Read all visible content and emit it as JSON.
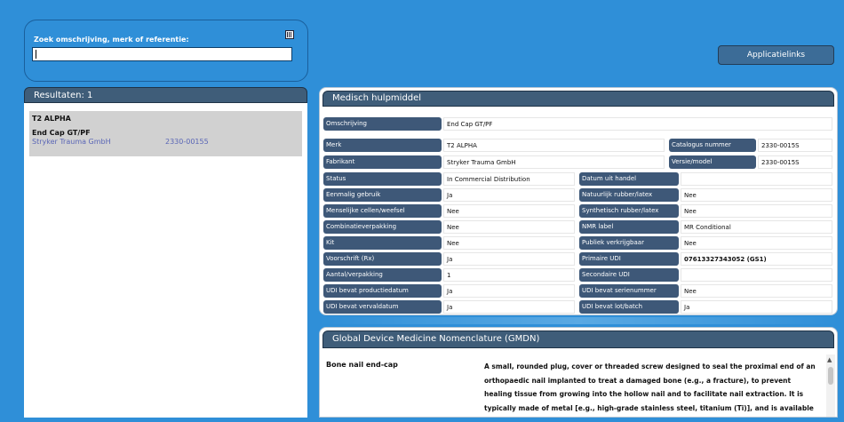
{
  "search": {
    "label": "Zoek omschrijving, merk of referentie:",
    "value": "",
    "placeholder": ""
  },
  "applinks_label": "Applicatielinks",
  "results": {
    "header": "Resultaten: 1",
    "item": {
      "brand": "T2 ALPHA",
      "description": "End Cap GT/PF",
      "manufacturer": "Stryker Trauma GmbH",
      "reference": "2330-00155"
    }
  },
  "device": {
    "header": "Medisch hulpmiddel",
    "fields": {
      "omschrijving": {
        "label": "Omschrijving",
        "value": "End Cap GT/PF"
      },
      "merk": {
        "label": "Merk",
        "value": "T2 ALPHA"
      },
      "catalogus": {
        "label": "Catalogus nummer",
        "value": "2330-0015S"
      },
      "fabrikant": {
        "label": "Fabrikant",
        "value": "Stryker Trauma GmbH"
      },
      "versie": {
        "label": "Versie/model",
        "value": "2330-0015S"
      },
      "status": {
        "label": "Status",
        "value": "In Commercial Distribution"
      },
      "datum_handel": {
        "label": "Datum uit handel",
        "value": ""
      },
      "eenmalig": {
        "label": "Eenmalig gebruik",
        "value": "Ja"
      },
      "rubber": {
        "label": "Natuurlijk rubber/latex",
        "value": "Nee"
      },
      "cellen": {
        "label": "Menselijke cellen/weefsel",
        "value": "Nee"
      },
      "synthetisch": {
        "label": "Synthetisch rubber/latex",
        "value": "Nee"
      },
      "combinatie": {
        "label": "Combinatieverpakking",
        "value": "Nee"
      },
      "nmr": {
        "label": "NMR label",
        "value": "MR Conditional"
      },
      "kit": {
        "label": "Kit",
        "value": "Nee"
      },
      "publiek": {
        "label": "Publiek verkrijgbaar",
        "value": "Nee"
      },
      "voorschrift": {
        "label": "Voorschrift (Rx)",
        "value": "Ja"
      },
      "primaire_udi": {
        "label": "Primaire UDI",
        "value": "07613327343052 (GS1)"
      },
      "aantal": {
        "label": "Aantal/verpakking",
        "value": "1"
      },
      "secundaire_udi": {
        "label": "Secondaire UDI",
        "value": ""
      },
      "udi_productie": {
        "label": "UDI bevat productiedatum",
        "value": "Ja"
      },
      "udi_serie": {
        "label": "UDI bevat serienummer",
        "value": "Nee"
      },
      "udi_verval": {
        "label": "UDI bevat vervaldatum",
        "value": "Ja"
      },
      "udi_lot": {
        "label": "UDI bevat lot/batch",
        "value": "Ja"
      }
    }
  },
  "gmdn": {
    "header": "Global Device Medicine Nomenclature (GMDN)",
    "term": "Bone nail end-cap",
    "description": "A small, rounded plug, cover or threaded screw designed to seal the proximal end of an orthopaedic nail implanted to treat a damaged bone (e.g., a fracture), to prevent healing tissue from growing into the hollow nail and to facilitate nail extraction. It is typically made of metal [e.g., high-grade stainless steel, titanium (Ti)], and is available in a variety of sizes. It may also be used to securely lock the most proximal oblique locking screw or help extend the length of a"
  },
  "icons": {
    "scan": "barcode-scan-icon",
    "scroll_up": "scroll-up-arrow-icon"
  }
}
